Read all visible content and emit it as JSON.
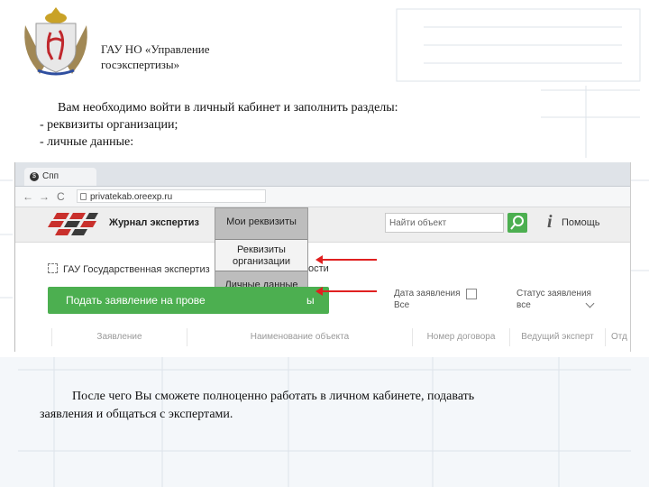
{
  "org": {
    "title_line1": "ГАУ НО «Управление",
    "title_line2": "госэкспертизы»"
  },
  "intro": {
    "line1": "Вам необходимо войти в личный кабинет и заполнить разделы:",
    "line2": "- реквизиты организации;",
    "line3": "- личные данные:"
  },
  "browser": {
    "tab_label": "Спп",
    "url": "privatekab.oreexp.ru",
    "nav": {
      "back": "←",
      "forward": "→",
      "reload": "C"
    }
  },
  "site": {
    "journal_title": "Журнал экспертиз",
    "search_placeholder": "Найти объект",
    "info_glyph": "i",
    "help_label": "Помощь",
    "dropdown": {
      "item1": "Мои реквизиты",
      "item2_line1": "Реквизиты",
      "item2_line2": "организации",
      "item3": "Личные данные"
    },
    "org_row": "ГАУ Государственная экспертиз",
    "org_row_tail": "ости",
    "submit_button": "Подать заявление на прове",
    "submit_tail": "ы",
    "filters": {
      "date_label": "Дата заявления",
      "date_value": "Все",
      "status_label": "Статус заявления",
      "status_value": "все"
    },
    "table_headers": [
      "Заявление",
      "Наименование объекта",
      "Номер договора",
      "Ведущий эксперт",
      "Отд"
    ]
  },
  "outro": {
    "line1": "После чего Вы сможете полноценно работать в личном кабинете, подавать",
    "line2": "заявления и общаться с экспертами."
  },
  "colors": {
    "accent_green": "#4caf50",
    "arrow_red": "#e02020"
  }
}
